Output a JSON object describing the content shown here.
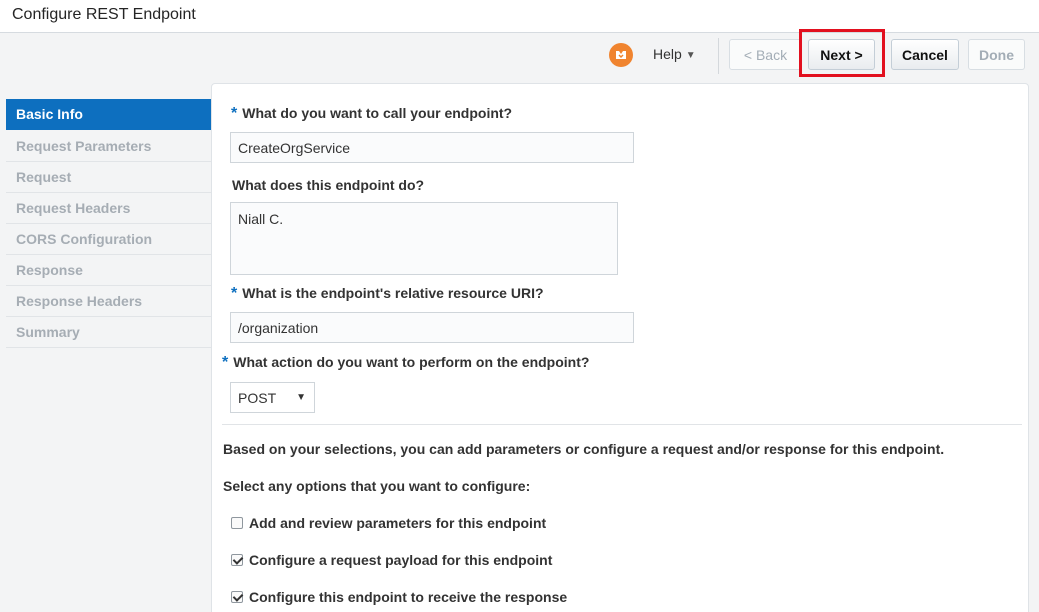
{
  "window": {
    "title": "Configure REST Endpoint"
  },
  "toolbar": {
    "help_icon": "help-badge-icon",
    "help_label": "Help",
    "help_caret": "▼",
    "back_label": "< Back",
    "next_label": "Next >",
    "cancel_label": "Cancel",
    "done_label": "Done",
    "highlight_color": "#e2101f"
  },
  "sidebar": {
    "items": [
      {
        "label": "Basic Info",
        "active": true
      },
      {
        "label": "Request Parameters"
      },
      {
        "label": "Request"
      },
      {
        "label": "Request Headers"
      },
      {
        "label": "CORS Configuration"
      },
      {
        "label": "Response"
      },
      {
        "label": "Response Headers"
      },
      {
        "label": "Summary"
      }
    ]
  },
  "form": {
    "required_marker": "*",
    "name": {
      "label": "What do you want to call your endpoint?",
      "value": "CreateOrgService"
    },
    "description": {
      "label": "What does this endpoint do?",
      "value": "Niall C."
    },
    "uri": {
      "label": "What is the endpoint's relative resource URI?",
      "value": "/organization"
    },
    "action": {
      "label": "What action do you want to perform on the endpoint?",
      "value": "POST",
      "caret": "▼"
    },
    "info_text": "Based on your selections, you can add parameters or configure a request and/or response for this endpoint.",
    "options_label": "Select any options that you want to configure:",
    "options": [
      {
        "label": "Add and review parameters for this endpoint",
        "checked": false
      },
      {
        "label": "Configure a request payload for this endpoint",
        "checked": true
      },
      {
        "label": "Configure this endpoint to receive the response",
        "checked": true
      }
    ]
  },
  "colors": {
    "accent": "#0d6fbf",
    "help_icon": "#f0842f"
  }
}
